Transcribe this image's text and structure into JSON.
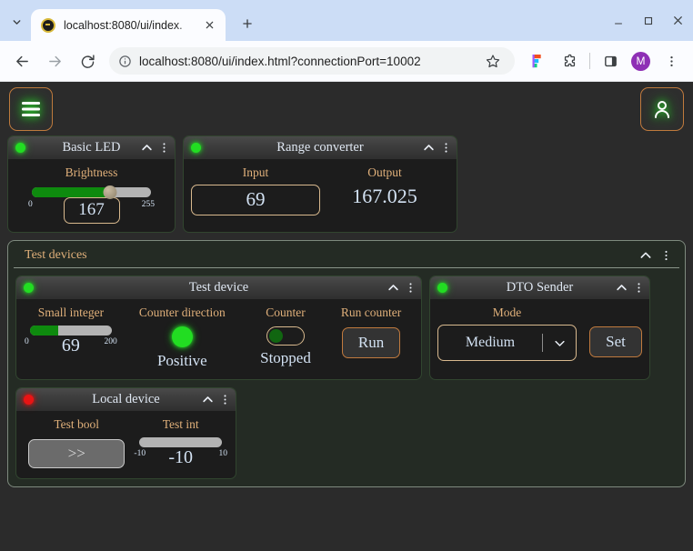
{
  "browser": {
    "tab": {
      "title": "localhost:8080/ui/index.",
      "favicon": "circle-logo-favicon",
      "close_icon": "close-icon"
    },
    "new_tab_icon": "plus-icon",
    "tab_list_icon": "chevron-down-icon",
    "window": {
      "minimize": "minimize-icon",
      "maximize": "maximize-icon",
      "close": "close-icon"
    },
    "toolbar": {
      "back_icon": "back-arrow-icon",
      "forward_icon": "forward-arrow-icon",
      "reload_icon": "reload-icon",
      "site_info_icon": "info-circle-icon",
      "url": "localhost:8080/ui/index.html?connectionPort=10002",
      "bookmark_icon": "star-icon",
      "figma_icon": "figma-extension-icon",
      "extensions_icon": "puzzle-piece-icon",
      "side_panel_icon": "side-panel-icon",
      "profile_initial": "M",
      "menu_icon": "three-dots-vertical-icon"
    }
  },
  "app": {
    "header": {
      "menu_button": "hamburger-menu-icon",
      "user_button": "user-account-icon"
    },
    "cards": {
      "basic_led": {
        "title": "Basic LED",
        "status": "connected",
        "status_color": "#22dd22",
        "collapse_icon": "chevron-up-icon",
        "menu_icon": "three-dots-vertical-icon",
        "control": {
          "label": "Brightness",
          "min": "0",
          "max": "255",
          "value": "167",
          "percent": 65.5
        }
      },
      "range_converter": {
        "title": "Range converter",
        "status": "connected",
        "status_color": "#22dd22",
        "collapse_icon": "chevron-up-icon",
        "menu_icon": "three-dots-vertical-icon",
        "input": {
          "label": "Input",
          "value": "69"
        },
        "output": {
          "label": "Output",
          "value": "167.025"
        }
      }
    },
    "panel": {
      "title": "Test devices",
      "collapse_icon": "chevron-up-icon",
      "menu_icon": "three-dots-vertical-icon",
      "devices": {
        "test_device": {
          "title": "Test device",
          "status": "connected",
          "status_color": "#22dd22",
          "collapse_icon": "chevron-up-icon",
          "menu_icon": "three-dots-vertical-icon",
          "small_integer": {
            "label": "Small integer",
            "min": "0",
            "max": "200",
            "value": "69",
            "percent": 34.5
          },
          "counter_direction": {
            "label": "Counter direction",
            "state": "Positive",
            "indicator_color": "#22dd22"
          },
          "counter": {
            "label": "Counter",
            "state": "Stopped",
            "toggle_on": false
          },
          "run_counter": {
            "label": "Run counter",
            "button": "Run"
          }
        },
        "dto_sender": {
          "title": "DTO Sender",
          "status": "connected",
          "status_color": "#22dd22",
          "collapse_icon": "chevron-up-icon",
          "menu_icon": "three-dots-vertical-icon",
          "mode": {
            "label": "Mode",
            "value": "Medium",
            "arrow_icon": "chevron-down-icon"
          },
          "set_button": "Set"
        },
        "local_device": {
          "title": "Local device",
          "status": "disconnected",
          "status_color": "#e81414",
          "collapse_icon": "chevron-up-icon",
          "menu_icon": "three-dots-vertical-icon",
          "test_bool": {
            "label": "Test bool",
            "button": ">>",
            "disabled": true
          },
          "test_int": {
            "label": "Test int",
            "min": "-10",
            "max": "10",
            "value": "-10",
            "percent": 0,
            "disabled": true
          }
        }
      }
    }
  }
}
